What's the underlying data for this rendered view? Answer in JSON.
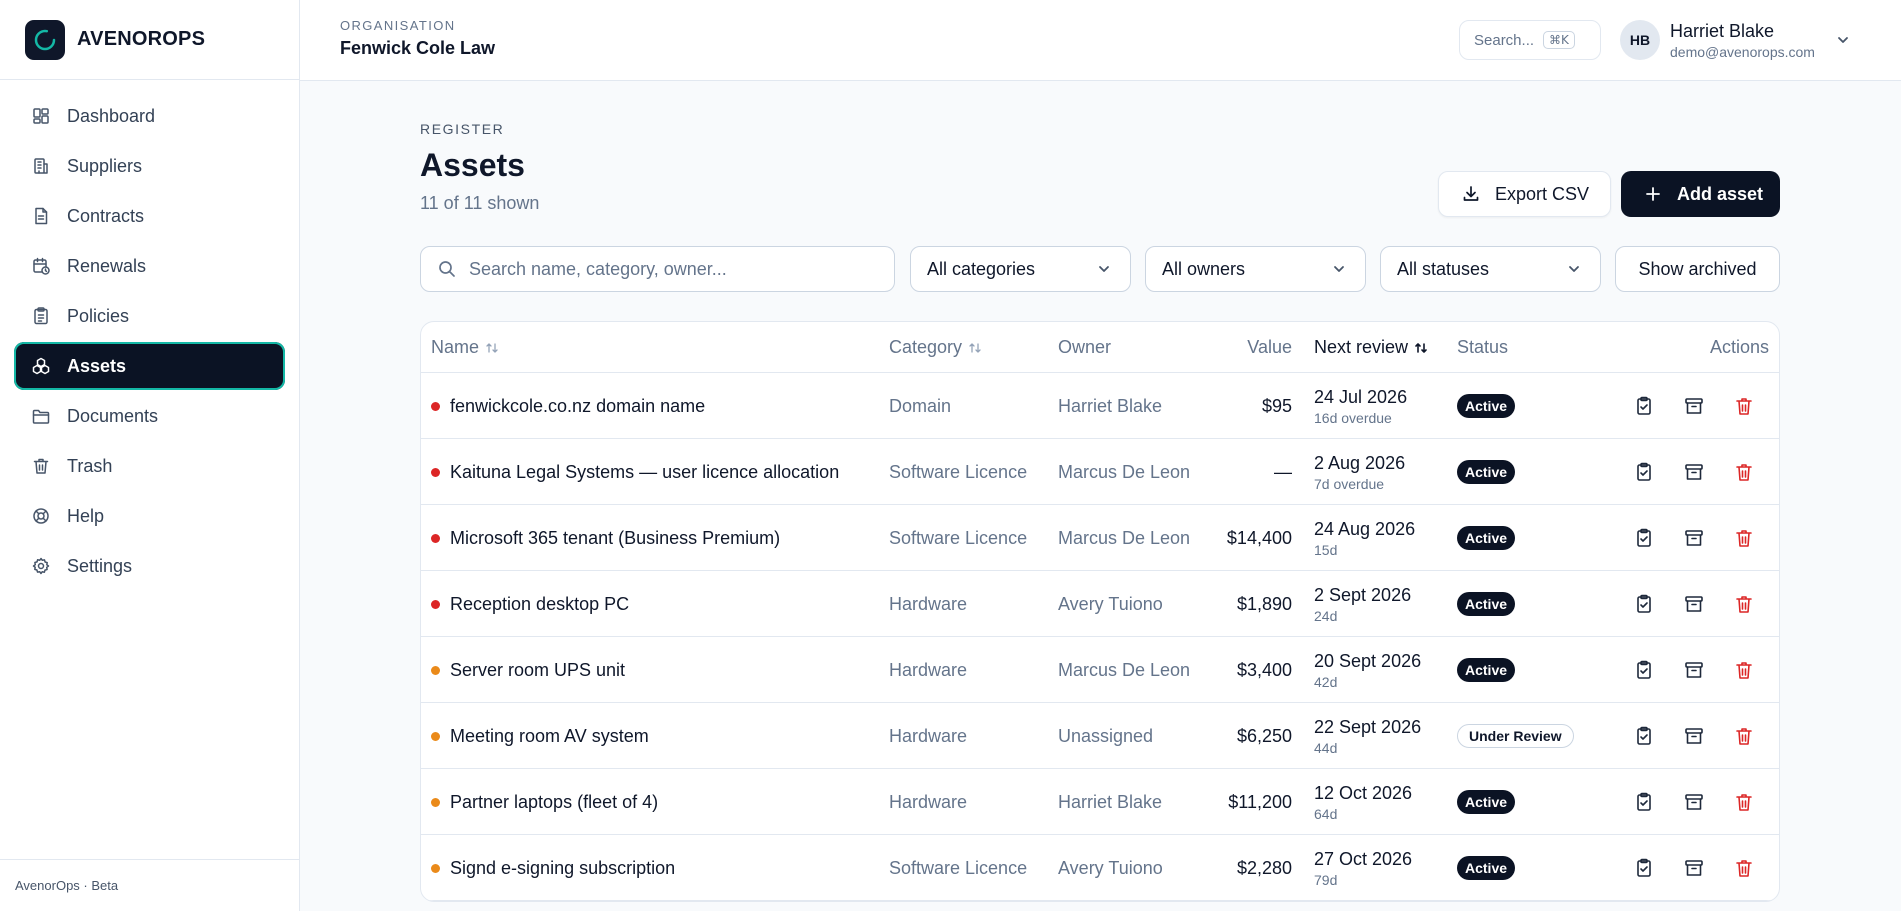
{
  "brand": {
    "name": "AVENOROPS"
  },
  "sidebar": {
    "items": [
      {
        "label": "Dashboard",
        "icon": "dashboard-icon"
      },
      {
        "label": "Suppliers",
        "icon": "building-icon"
      },
      {
        "label": "Contracts",
        "icon": "file-text-icon"
      },
      {
        "label": "Renewals",
        "icon": "calendar-clock-icon"
      },
      {
        "label": "Policies",
        "icon": "clipboard-list-icon"
      },
      {
        "label": "Assets",
        "icon": "boxes-icon",
        "active": true
      },
      {
        "label": "Documents",
        "icon": "folder-icon"
      },
      {
        "label": "Trash",
        "icon": "trash-icon"
      },
      {
        "label": "Help",
        "icon": "life-buoy-icon"
      },
      {
        "label": "Settings",
        "icon": "gear-icon"
      }
    ],
    "footer": "AvenorOps · Beta"
  },
  "topbar": {
    "org_label": "ORGANISATION",
    "org_name": "Fenwick Cole Law",
    "search_label": "Search...",
    "search_shortcut": "⌘K",
    "user": {
      "initials": "HB",
      "name": "Harriet Blake",
      "email": "demo@avenorops.com"
    }
  },
  "page": {
    "eyebrow": "REGISTER",
    "title": "Assets",
    "subtitle": "11 of 11 shown",
    "export_label": "Export CSV",
    "add_label": "Add asset"
  },
  "filters": {
    "search_placeholder": "Search name, category, owner...",
    "category": "All categories",
    "owner": "All owners",
    "status": "All statuses",
    "archived_label": "Show archived"
  },
  "table": {
    "columns": {
      "name": "Name",
      "category": "Category",
      "owner": "Owner",
      "value": "Value",
      "next_review": "Next review",
      "status": "Status",
      "actions": "Actions"
    },
    "rows": [
      {
        "name": "fenwickcole.co.nz domain name",
        "category": "Domain",
        "owner": "Harriet Blake",
        "value": "$95",
        "review_date": "24 Jul 2026",
        "review_rel": "16d overdue",
        "status": "Active",
        "urgency": "red"
      },
      {
        "name": "Kaituna Legal Systems — user licence allocation",
        "category": "Software Licence",
        "owner": "Marcus De Leon",
        "value": "—",
        "review_date": "2 Aug 2026",
        "review_rel": "7d overdue",
        "status": "Active",
        "urgency": "red"
      },
      {
        "name": "Microsoft 365 tenant (Business Premium)",
        "category": "Software Licence",
        "owner": "Marcus De Leon",
        "value": "$14,400",
        "review_date": "24 Aug 2026",
        "review_rel": "15d",
        "status": "Active",
        "urgency": "red"
      },
      {
        "name": "Reception desktop PC",
        "category": "Hardware",
        "owner": "Avery Tuiono",
        "value": "$1,890",
        "review_date": "2 Sept 2026",
        "review_rel": "24d",
        "status": "Active",
        "urgency": "red"
      },
      {
        "name": "Server room UPS unit",
        "category": "Hardware",
        "owner": "Marcus De Leon",
        "value": "$3,400",
        "review_date": "20 Sept 2026",
        "review_rel": "42d",
        "status": "Active",
        "urgency": "orange"
      },
      {
        "name": "Meeting room AV system",
        "category": "Hardware",
        "owner": "Unassigned",
        "value": "$6,250",
        "review_date": "22 Sept 2026",
        "review_rel": "44d",
        "status": "Under Review",
        "urgency": "orange"
      },
      {
        "name": "Partner laptops (fleet of 4)",
        "category": "Hardware",
        "owner": "Harriet Blake",
        "value": "$11,200",
        "review_date": "12 Oct 2026",
        "review_rel": "64d",
        "status": "Active",
        "urgency": "orange"
      },
      {
        "name": "Signd e-signing subscription",
        "category": "Software Licence",
        "owner": "Avery Tuiono",
        "value": "$2,280",
        "review_date": "27 Oct 2026",
        "review_rel": "79d",
        "status": "Active",
        "urgency": "orange"
      }
    ]
  },
  "colors": {
    "red": "#dc2626",
    "orange": "#ea8a1a",
    "primary": "#0b1324",
    "accent": "#14b8a6"
  }
}
